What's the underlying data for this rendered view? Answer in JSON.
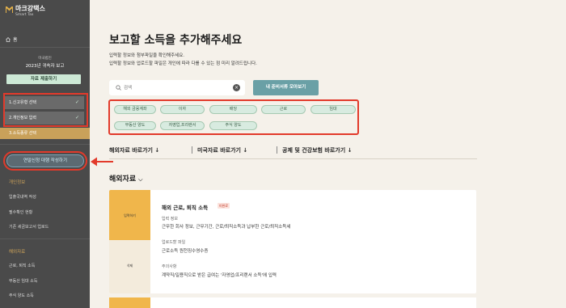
{
  "sidebar": {
    "logo_name": "마크강택스",
    "logo_sub": "Smart Tax",
    "home_label": "홈",
    "report_label": "미국법인",
    "report_title": "2023년 귀속자 보고",
    "submit_button": "자료 제출하기",
    "steps": [
      {
        "label": "1.신고유형 선택",
        "check": "✓"
      },
      {
        "label": "2.개인정보 입력",
        "check": "✓"
      },
      {
        "label": "3.소득종류 선택"
      }
    ],
    "doc_button": "연말신청 대행 작성하기",
    "section_personal": "개인정보",
    "personal_items": [
      "입출국내역 작성",
      "필수확인 현황",
      "기존 세금보고서 업로드"
    ],
    "section_overseas": "해외자료",
    "overseas_items": [
      "근로, 퇴직 소득",
      "부동산 임대 소득",
      "주식 양도 소득"
    ]
  },
  "main": {
    "title": "보고할 소득을 추가해주세요",
    "sub1": "입력할 정보와 첨부파일을 확인해주세요.",
    "sub2": "입력할 정보와 업로드할 파일은 개인에 따라 다를 수 있는 점 미리 알려드립니다.",
    "search_placeholder": "검색",
    "clear_icon": "×",
    "doc_collect_button": "내 준비서류 모아보기",
    "chips": [
      "해외 금융계좌",
      "이자",
      "배당",
      "근로",
      "임대",
      "부동산 양도",
      "자영업,프리랜서",
      "주식 양도"
    ],
    "quick_links": [
      "해외자료 바로가기 ↓",
      "미국자료 바로가기 ↓",
      "공제 및 건강보험 바로가기 ↓"
    ],
    "overseas_heading": "해외자료",
    "overseas_chevron": "⌵",
    "card": {
      "left_label_1": "입력하기",
      "left_label_2": "삭제",
      "title": "해외 근로, 퇴직 소득",
      "badge": "미완료",
      "info_label": "입력 정보",
      "info_value": "근무한 회사 정보, 근무기간, 근로/퇴직소득과 납부한 근로/퇴직소득세",
      "file_label": "업로드할 파일",
      "file_value": "근로소득 원천징수영수증",
      "note_label": "주의사항",
      "note_value": "계약직/일용직으로 받은 급여는 '자영업/프리랜서 소득'에 입력"
    }
  },
  "colors": {
    "sidebar_bg": "#4a4a4a",
    "accent_gold": "#c9a15a",
    "highlight_red": "#e23a2b",
    "mint": "#cde9d6",
    "teal_button": "#6aa0a6",
    "card_accent": "#f0b64b"
  }
}
